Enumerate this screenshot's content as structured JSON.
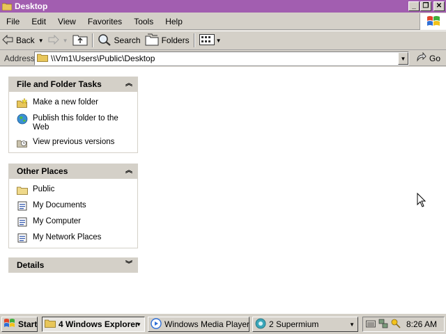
{
  "window": {
    "title": "Desktop",
    "controls": {
      "minimize": "_",
      "maximize": "❐",
      "close": "✕"
    }
  },
  "menu": [
    "File",
    "Edit",
    "View",
    "Favorites",
    "Tools",
    "Help"
  ],
  "toolbar": {
    "back_label": "Back",
    "search_label": "Search",
    "folders_label": "Folders"
  },
  "address": {
    "label": "Address",
    "value": "\\\\Vm1\\Users\\Public\\Desktop",
    "go_label": "Go"
  },
  "panels": {
    "file_tasks": {
      "title": "File and Folder Tasks",
      "items": [
        {
          "label": "Make a new folder",
          "icon": "new-folder-icon"
        },
        {
          "label": "Publish this folder to the Web",
          "icon": "globe-icon"
        },
        {
          "label": "View previous versions",
          "icon": "previous-versions-icon"
        }
      ]
    },
    "other_places": {
      "title": "Other Places",
      "items": [
        {
          "label": "Public",
          "icon": "folder-icon"
        },
        {
          "label": "My Documents",
          "icon": "documents-icon"
        },
        {
          "label": "My Computer",
          "icon": "computer-icon"
        },
        {
          "label": "My Network Places",
          "icon": "network-icon"
        }
      ]
    },
    "details": {
      "title": "Details"
    }
  },
  "taskbar": {
    "start_label": "Start",
    "tasks": [
      {
        "label": "4 Windows Explorer",
        "active": true
      },
      {
        "label": "Windows Media Player",
        "active": false
      },
      {
        "label": "2 Supermium",
        "active": false
      }
    ],
    "clock": "8:26 AM"
  },
  "colors": {
    "titlebar": "#a25eb0",
    "chrome": "#d4d0c8",
    "content_bg": "#ffffff"
  }
}
